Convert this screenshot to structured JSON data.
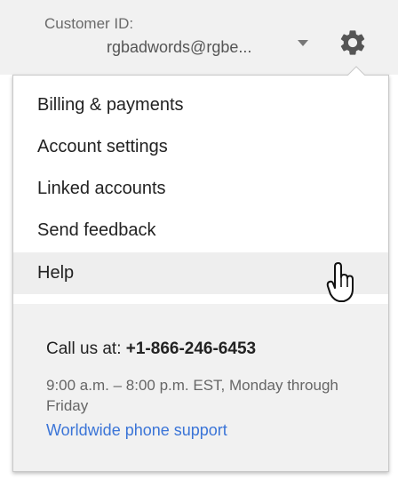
{
  "header": {
    "customer_label": "Customer ID:",
    "customer_value": "rgbadwords@rgbe...",
    "icons": {
      "dropdown": "chevron-down-icon",
      "settings": "gear-icon"
    }
  },
  "menu": {
    "items": [
      {
        "label": "Billing & payments"
      },
      {
        "label": "Account settings"
      },
      {
        "label": "Linked accounts"
      },
      {
        "label": "Send feedback"
      },
      {
        "label": "Help",
        "hovered": true
      }
    ]
  },
  "support": {
    "call_prefix": "Call us at:",
    "phone": "+1-866-246-6453",
    "hours": "9:00 a.m. – 8:00 p.m. EST, Monday through Friday",
    "link": "Worldwide phone support"
  },
  "colors": {
    "link": "#3a74d7",
    "menu_hover": "#eeeeee",
    "panel_bg": "#f1f1f1"
  }
}
